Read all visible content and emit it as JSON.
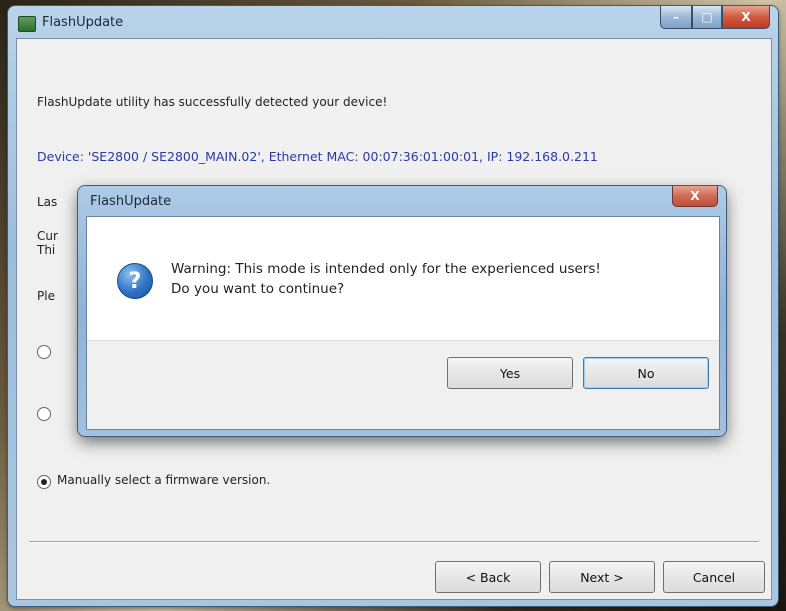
{
  "window": {
    "title": "FlashUpdate",
    "buttons": {
      "minimize": "–",
      "maximize": "□",
      "close": "X"
    }
  },
  "main": {
    "detected_text": "FlashUpdate utility has successfully detected your device!",
    "device_text": "Device: 'SE2800 / SE2800_MAIN.02', Ethernet MAC: 00:07:36:01:00:01, IP: 192.168.0.211",
    "partial": {
      "last": "Las",
      "cur": "Cur",
      "this": "Thi",
      "please": "Ple"
    },
    "manual_radio_label": "Manually select a firmware version.",
    "radios": [
      {
        "name": "option-1",
        "checked": false
      },
      {
        "name": "option-2",
        "checked": false
      },
      {
        "name": "manual",
        "checked": true
      }
    ]
  },
  "footer": {
    "back": "< Back",
    "next": "Next >",
    "cancel": "Cancel"
  },
  "dialog": {
    "title": "FlashUpdate",
    "close": "X",
    "icon": "question-icon",
    "message_line1": "Warning: This mode is intended only for the experienced users!",
    "message_line2": "Do you want to continue?",
    "yes": "Yes",
    "no": "No"
  }
}
